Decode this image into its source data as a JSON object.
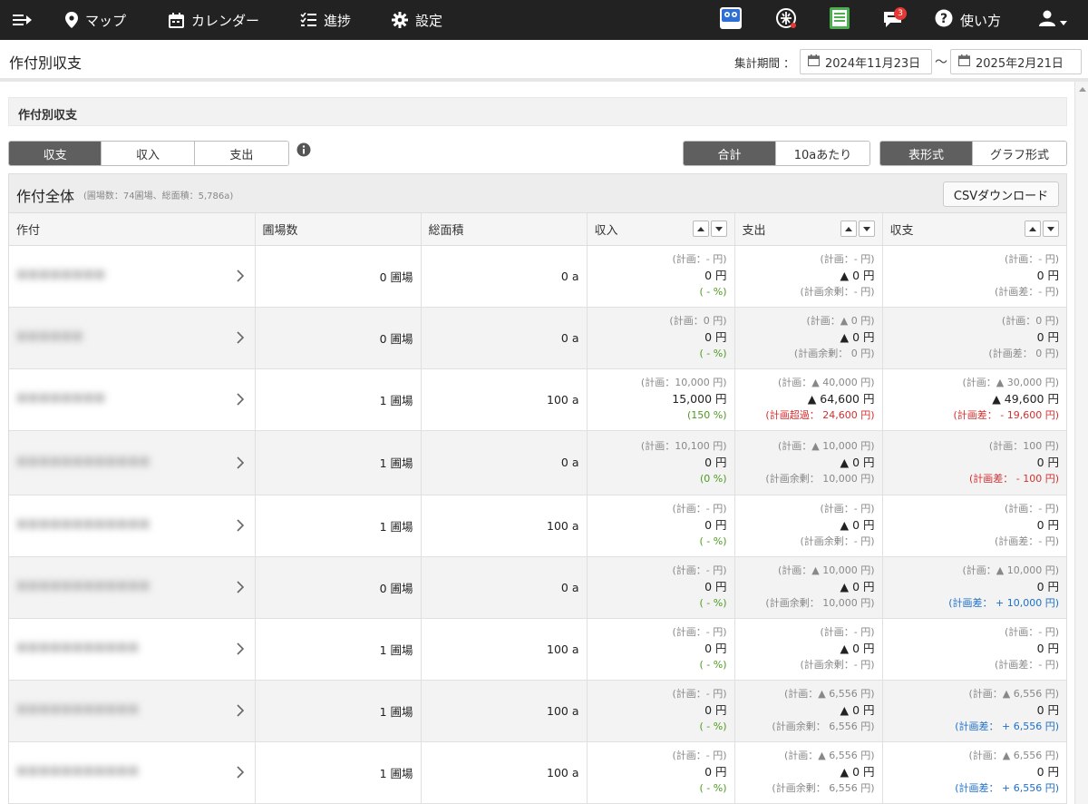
{
  "nav": {
    "map_label": "マップ",
    "calendar_label": "カレンダー",
    "progress_label": "進捗",
    "settings_label": "設定",
    "mgr_label": "mgr",
    "news_badge": "3",
    "help_label": "使い方"
  },
  "page": {
    "title": "作付別収支",
    "period_label": "集計期間 ：",
    "date_from": "2024年11月23日",
    "tilde": "〜",
    "date_to": "2025年2月21日"
  },
  "section": {
    "title": "作付別収支"
  },
  "toggles": {
    "type": [
      "収支",
      "収入",
      "支出"
    ],
    "type_active": 0,
    "unit": [
      "合計",
      "10aあたり"
    ],
    "unit_active": 0,
    "view": [
      "表形式",
      "グラフ形式"
    ],
    "view_active": 0
  },
  "panel": {
    "title": "作付全体",
    "subtitle": "(圃場数：74圃場、総面積：5,786a)",
    "csv_label": "CSVダウンロード"
  },
  "columns": [
    "作付",
    "圃場数",
    "総面積",
    "収入",
    "支出",
    "収支"
  ],
  "colors": {
    "nav_bg": "#222222",
    "active_toggle": "#5f5f5f",
    "green": "#4d9a1f",
    "red": "#d32f2f",
    "blue": "#1e6fc8"
  },
  "rows": [
    {
      "crop": "■■■■■■■■",
      "fields": "0 圃場",
      "area": "0 a",
      "income_plan": "(計画：- 円)",
      "income": "0 円",
      "income_note": "( - %)",
      "income_note_color": "green",
      "expense_plan": "(計画：- 円)",
      "expense": "▲ 0 円",
      "expense_note": "(計画余剰：- 円)",
      "expense_note_color": "gray",
      "balance_plan": "(計画：- 円)",
      "balance": "0 円",
      "balance_note": "(計画差：- 円)",
      "balance_note_color": "gray"
    },
    {
      "crop": "■■■■■■",
      "fields": "0 圃場",
      "area": "0 a",
      "income_plan": "(計画：0 円)",
      "income": "0 円",
      "income_note": "( - %)",
      "income_note_color": "green",
      "expense_plan": "(計画：▲ 0 円)",
      "expense": "▲ 0 円",
      "expense_note": "(計画余剰： 0 円)",
      "expense_note_color": "gray",
      "balance_plan": "(計画：0 円)",
      "balance": "0 円",
      "balance_note": "(計画差： 0 円)",
      "balance_note_color": "gray"
    },
    {
      "crop": "■■■■■■■■",
      "fields": "1 圃場",
      "area": "100 a",
      "income_plan": "(計画：10,000 円)",
      "income": "15,000 円",
      "income_note": "(150 %)",
      "income_note_color": "green",
      "expense_plan": "(計画：▲ 40,000 円)",
      "expense": "▲ 64,600 円",
      "expense_note": "(計画超過： 24,600 円)",
      "expense_note_color": "red",
      "balance_plan": "(計画：▲ 30,000 円)",
      "balance": "▲ 49,600 円",
      "balance_note": "(計画差： - 19,600 円)",
      "balance_note_color": "red"
    },
    {
      "crop": "■■■■■■■■■■■■",
      "fields": "1 圃場",
      "area": "0 a",
      "income_plan": "(計画：10,100 円)",
      "income": "0 円",
      "income_note": "(0 %)",
      "income_note_color": "green",
      "expense_plan": "(計画：▲ 10,000 円)",
      "expense": "▲ 0 円",
      "expense_note": "(計画余剰： 10,000 円)",
      "expense_note_color": "gray",
      "balance_plan": "(計画：100 円)",
      "balance": "0 円",
      "balance_note": "(計画差： - 100 円)",
      "balance_note_color": "red"
    },
    {
      "crop": "■■■■■■■■■■■■",
      "fields": "1 圃場",
      "area": "100 a",
      "income_plan": "(計画：- 円)",
      "income": "0 円",
      "income_note": "( - %)",
      "income_note_color": "green",
      "expense_plan": "(計画：- 円)",
      "expense": "▲ 0 円",
      "expense_note": "(計画余剰：- 円)",
      "expense_note_color": "gray",
      "balance_plan": "(計画：- 円)",
      "balance": "0 円",
      "balance_note": "(計画差：- 円)",
      "balance_note_color": "gray"
    },
    {
      "crop": "■■■■■■■■■■■■",
      "fields": "0 圃場",
      "area": "0 a",
      "income_plan": "(計画：- 円)",
      "income": "0 円",
      "income_note": "( - %)",
      "income_note_color": "green",
      "expense_plan": "(計画：▲ 10,000 円)",
      "expense": "▲ 0 円",
      "expense_note": "(計画余剰： 10,000 円)",
      "expense_note_color": "gray",
      "balance_plan": "(計画：▲ 10,000 円)",
      "balance": "0 円",
      "balance_note": "(計画差： + 10,000 円)",
      "balance_note_color": "blue"
    },
    {
      "crop": "■■■■■■■■■■■",
      "fields": "1 圃場",
      "area": "100 a",
      "income_plan": "(計画：- 円)",
      "income": "0 円",
      "income_note": "( - %)",
      "income_note_color": "green",
      "expense_plan": "(計画：- 円)",
      "expense": "▲ 0 円",
      "expense_note": "(計画余剰：- 円)",
      "expense_note_color": "gray",
      "balance_plan": "(計画：- 円)",
      "balance": "0 円",
      "balance_note": "(計画差：- 円)",
      "balance_note_color": "gray"
    },
    {
      "crop": "■■■■■■■■■■■",
      "fields": "1 圃場",
      "area": "100 a",
      "income_plan": "(計画：- 円)",
      "income": "0 円",
      "income_note": "( - %)",
      "income_note_color": "green",
      "expense_plan": "(計画：▲ 6,556 円)",
      "expense": "▲ 0 円",
      "expense_note": "(計画余剰： 6,556 円)",
      "expense_note_color": "gray",
      "balance_plan": "(計画：▲ 6,556 円)",
      "balance": "0 円",
      "balance_note": "(計画差： + 6,556 円)",
      "balance_note_color": "blue"
    },
    {
      "crop": "■■■■■■■■■■■",
      "fields": "1 圃場",
      "area": "100 a",
      "income_plan": "(計画：- 円)",
      "income": "0 円",
      "income_note": "( - %)",
      "income_note_color": "green",
      "expense_plan": "(計画：▲ 6,556 円)",
      "expense": "▲ 0 円",
      "expense_note": "(計画余剰： 6,556 円)",
      "expense_note_color": "gray",
      "balance_plan": "(計画：▲ 6,556 円)",
      "balance": "0 円",
      "balance_note": "(計画差： + 6,556 円)",
      "balance_note_color": "blue"
    }
  ]
}
